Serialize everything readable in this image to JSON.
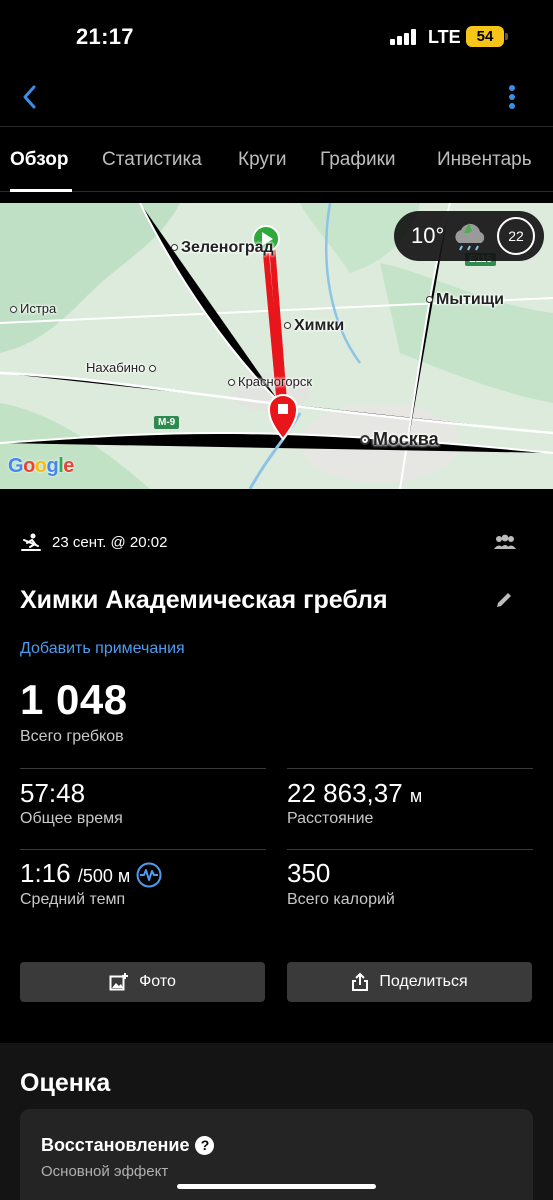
{
  "status_bar": {
    "time": "21:17",
    "network": "LTE",
    "battery": "54"
  },
  "nav": {
    "back_icon": "chevron-left-icon",
    "more_icon": "vertical-ellipsis-icon",
    "accent": "#3a8ee6"
  },
  "tabs": [
    {
      "label": "Обзор",
      "active": true
    },
    {
      "label": "Статистика",
      "active": false
    },
    {
      "label": "Круги",
      "active": false
    },
    {
      "label": "Графики",
      "active": false
    },
    {
      "label": "Инвентарь",
      "active": false
    }
  ],
  "map": {
    "labels": {
      "zelenograd": "Зеленоград",
      "istra": "Истра",
      "mytishchi": "Мытищи",
      "khimki": "Химки",
      "nakhabino": "Нахабино",
      "krasnogorsk": "Красногорск",
      "moscow": "Москва"
    },
    "road_badges": {
      "m9": "М-9",
      "e115": "E115"
    },
    "attribution": "Google",
    "weather": {
      "temperature": "10°",
      "wind": "22",
      "icon": "cloud-rain-icon"
    },
    "route_color": "#e8151b"
  },
  "activity": {
    "icon": "rowing-icon",
    "datetime": "23 сент. @ 20:02",
    "group_icon": "group-icon",
    "title": "Химки Академическая гребля",
    "add_note": "Добавить примечания",
    "total_strokes": {
      "value": "1 048",
      "label": "Всего гребков"
    },
    "stats": {
      "total_time": {
        "value": "57:48",
        "label": "Общее время"
      },
      "distance": {
        "value": "22 863,37",
        "unit": "м",
        "label": "Расстояние"
      },
      "avg_pace": {
        "value": "1:16",
        "unit": "/500 м",
        "label": "Средний темп"
      },
      "calories": {
        "value": "350",
        "label": "Всего калорий"
      }
    }
  },
  "actions": {
    "photo": "Фото",
    "share": "Поделиться"
  },
  "rating": {
    "title": "Оценка",
    "card_title": "Восстановление",
    "help": "?",
    "card_subtitle": "Основной эффект"
  }
}
